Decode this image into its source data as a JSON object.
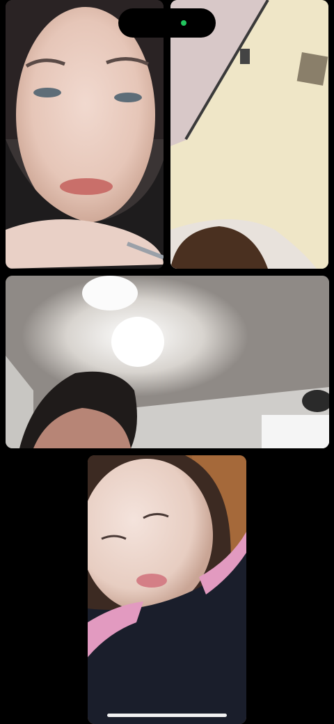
{
  "call": {
    "participants": [
      {
        "id": "participant-1",
        "view": "face-closeup-dark-shirt"
      },
      {
        "id": "participant-2",
        "view": "ceiling-and-top-of-head"
      },
      {
        "id": "participant-3",
        "view": "ceiling-light-and-face"
      },
      {
        "id": "participant-4",
        "view": "face-dark-hoodie-pink-stripe"
      }
    ]
  },
  "status": {
    "camera_indicator_color": "#22c55e"
  },
  "colors": {
    "background": "#000000",
    "home_indicator": "#f2f2f2"
  }
}
